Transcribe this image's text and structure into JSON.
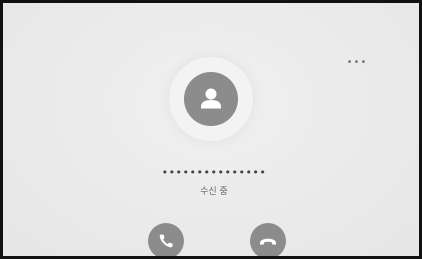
{
  "call": {
    "more_label": "•••",
    "caller_number": "•••••••••••••••",
    "status": "수신 중"
  },
  "icons": {
    "more": "more-horizontal-icon",
    "avatar": "person-icon",
    "answer": "phone-answer-icon",
    "decline": "phone-hangup-icon"
  },
  "colors": {
    "background": "#ebebeb",
    "button": "#8c8c8c",
    "icon": "#ffffff",
    "frame": "#111111"
  }
}
